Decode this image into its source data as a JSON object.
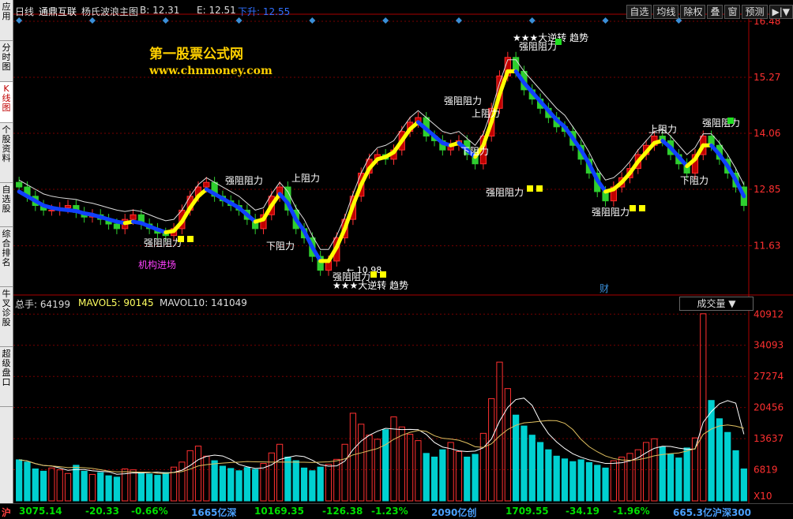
{
  "sidebar": {
    "tabs": [
      "应用",
      "分时图",
      "K线图",
      "个股资料",
      "自选股",
      "综合排名",
      "牛叉诊股",
      "超级盘口"
    ],
    "active_index": 2
  },
  "header": {
    "period": "日线",
    "stock_name": "通鼎互联",
    "indicator": "杨氏波浪主图",
    "b_label": "B: 12.31",
    "e_label": "E: 12.51",
    "trend_label": "下升: 12.55"
  },
  "toolbar": {
    "items": [
      "自选",
      "均线",
      "除权",
      "叠",
      "窗",
      "预测",
      "▶|▼"
    ]
  },
  "watermark": {
    "title": "第一股票公式网",
    "url": "www.chnmoney.com"
  },
  "price_axis": {
    "labels": [
      "16.48",
      "15.27",
      "14.06",
      "12.85",
      "11.63"
    ]
  },
  "volume_axis": {
    "labels": [
      "40912",
      "34093",
      "27274",
      "20456",
      "13637",
      "6819",
      "X10"
    ]
  },
  "annotations": {
    "resist": "阻力",
    "strong_resist": "强阻阻力",
    "up_resist": "上阻力",
    "down_resist": "下阻力",
    "institution": "机构进场",
    "low_price": "← 10.98",
    "reversal": "★★★大逆转  趋势",
    "cai": "财"
  },
  "volume_header": {
    "total": "总手: 64199",
    "mavol5": "MAVOL5: 90145",
    "mavol10": "MAVOL10: 141049",
    "dropdown": "成交量"
  },
  "statusbar": {
    "items": [
      {
        "text": "沪",
        "color": "#ff4040"
      },
      {
        "text": "3075.14",
        "color": "#00e000"
      },
      {
        "text": "-20.33",
        "color": "#00e000"
      },
      {
        "text": "-0.66%",
        "color": "#00e000"
      },
      {
        "text": "1665亿深",
        "color": "#4aa0ff"
      },
      {
        "text": "10169.35",
        "color": "#00e000"
      },
      {
        "text": "-126.38",
        "color": "#00e000"
      },
      {
        "text": "-1.23%",
        "color": "#00e000"
      },
      {
        "text": "2090亿创",
        "color": "#4aa0ff"
      },
      {
        "text": "1709.55",
        "color": "#00e000"
      },
      {
        "text": "-34.19",
        "color": "#00e000"
      },
      {
        "text": "-1.96%",
        "color": "#00e000"
      },
      {
        "text": "665.3亿沪深300",
        "color": "#4aa0ff"
      }
    ]
  },
  "chart_data": {
    "type": "candlestick",
    "price_range": [
      10.6,
      16.6
    ],
    "volume_range": [
      0,
      42000
    ],
    "price_ticks": [
      16.48,
      15.27,
      14.06,
      12.85,
      11.63
    ],
    "volume_ticks": [
      40912,
      34093,
      27274,
      20456,
      13637,
      6819
    ],
    "candles": [
      {
        "c": 12.9
      },
      {
        "c": 12.7
      },
      {
        "c": 12.5
      },
      {
        "c": 12.4
      },
      {
        "c": 12.4
      },
      {
        "c": 12.45
      },
      {
        "c": 12.5
      },
      {
        "c": 12.35
      },
      {
        "c": 12.25
      },
      {
        "c": 12.3
      },
      {
        "c": 12.2
      },
      {
        "c": 12.1
      },
      {
        "c": 12.0
      },
      {
        "c": 12.2
      },
      {
        "c": 12.3
      },
      {
        "c": 12.1
      },
      {
        "c": 12.0
      },
      {
        "c": 11.9
      },
      {
        "c": 11.85
      },
      {
        "c": 12.0
      },
      {
        "c": 12.4
      },
      {
        "c": 12.7
      },
      {
        "c": 12.9
      },
      {
        "c": 13.0
      },
      {
        "c": 12.7
      },
      {
        "c": 12.6
      },
      {
        "c": 12.5
      },
      {
        "c": 12.4
      },
      {
        "c": 12.2
      },
      {
        "c": 12.0
      },
      {
        "c": 12.3
      },
      {
        "c": 12.7
      },
      {
        "c": 12.9
      },
      {
        "c": 12.4
      },
      {
        "c": 12.0
      },
      {
        "c": 11.8
      },
      {
        "c": 11.4
      },
      {
        "c": 11.1
      },
      {
        "c": 11.3
      },
      {
        "c": 11.8
      },
      {
        "c": 12.2
      },
      {
        "c": 12.7
      },
      {
        "c": 13.2
      },
      {
        "c": 13.5
      },
      {
        "c": 13.6
      },
      {
        "c": 13.5
      },
      {
        "c": 13.7
      },
      {
        "c": 14.1
      },
      {
        "c": 14.3
      },
      {
        "c": 14.4
      },
      {
        "c": 14.0
      },
      {
        "c": 13.9
      },
      {
        "c": 13.7
      },
      {
        "c": 13.8
      },
      {
        "c": 13.9
      },
      {
        "c": 13.6
      },
      {
        "c": 13.4
      },
      {
        "c": 14.0
      },
      {
        "c": 14.6
      },
      {
        "c": 15.3
      },
      {
        "c": 15.7
      },
      {
        "c": 15.4
      },
      {
        "c": 15.0
      },
      {
        "c": 14.8
      },
      {
        "c": 14.6
      },
      {
        "c": 14.4
      },
      {
        "c": 14.2
      },
      {
        "c": 14.1
      },
      {
        "c": 13.8
      },
      {
        "c": 13.5
      },
      {
        "c": 13.2
      },
      {
        "c": 12.8
      },
      {
        "c": 12.6
      },
      {
        "c": 12.9
      },
      {
        "c": 13.1
      },
      {
        "c": 13.3
      },
      {
        "c": 13.6
      },
      {
        "c": 13.8
      },
      {
        "c": 14.0
      },
      {
        "c": 13.9
      },
      {
        "c": 13.6
      },
      {
        "c": 13.4
      },
      {
        "c": 13.2
      },
      {
        "c": 13.6
      },
      {
        "c": 14.0
      },
      {
        "c": 13.8
      },
      {
        "c": 13.5
      },
      {
        "c": 13.2
      },
      {
        "c": 12.9
      },
      {
        "c": 12.5
      }
    ],
    "volumes": [
      9000,
      8500,
      7000,
      6500,
      7200,
      6800,
      6000,
      7800,
      6500,
      5800,
      6200,
      5500,
      5200,
      7000,
      6800,
      6100,
      5900,
      5600,
      6200,
      7400,
      8500,
      11000,
      12000,
      9800,
      8800,
      7600,
      7100,
      6600,
      7300,
      6900,
      8200,
      10500,
      12400,
      9600,
      8800,
      7200,
      6600,
      7400,
      8000,
      9100,
      12400,
      19200,
      16800,
      14400,
      13500,
      15600,
      18400,
      16200,
      14600,
      13200,
      10400,
      9600,
      11200,
      12800,
      10800,
      9600,
      10200,
      14800,
      22400,
      30400,
      24600,
      18800,
      16400,
      14400,
      12800,
      11200,
      9800,
      9200,
      8600,
      9000,
      8400,
      7800,
      7200,
      8800,
      9600,
      10400,
      11200,
      12800,
      13600,
      11800,
      10200,
      9400,
      11600,
      13800,
      41000,
      22000,
      18000,
      15000,
      11000,
      7000
    ],
    "ma_line": [
      12.8,
      12.7,
      12.6,
      12.5,
      12.45,
      12.42,
      12.4,
      12.38,
      12.33,
      12.3,
      12.25,
      12.2,
      12.15,
      12.12,
      12.15,
      12.12,
      12.05,
      11.98,
      11.92,
      11.95,
      12.15,
      12.45,
      12.7,
      12.85,
      12.75,
      12.65,
      12.55,
      12.45,
      12.3,
      12.15,
      12.2,
      12.5,
      12.75,
      12.55,
      12.2,
      11.95,
      11.6,
      11.3,
      11.3,
      11.6,
      12.0,
      12.5,
      12.95,
      13.3,
      13.5,
      13.55,
      13.65,
      13.9,
      14.15,
      14.3,
      14.15,
      14.0,
      13.85,
      13.8,
      13.85,
      13.7,
      13.55,
      13.8,
      14.3,
      14.9,
      15.4,
      15.4,
      15.15,
      14.95,
      14.75,
      14.55,
      14.35,
      14.2,
      13.95,
      13.7,
      13.4,
      13.05,
      12.8,
      12.85,
      13.0,
      13.2,
      13.45,
      13.65,
      13.85,
      13.9,
      13.75,
      13.55,
      13.35,
      13.5,
      13.8,
      13.8,
      13.6,
      13.35,
      13.05,
      12.7
    ]
  }
}
